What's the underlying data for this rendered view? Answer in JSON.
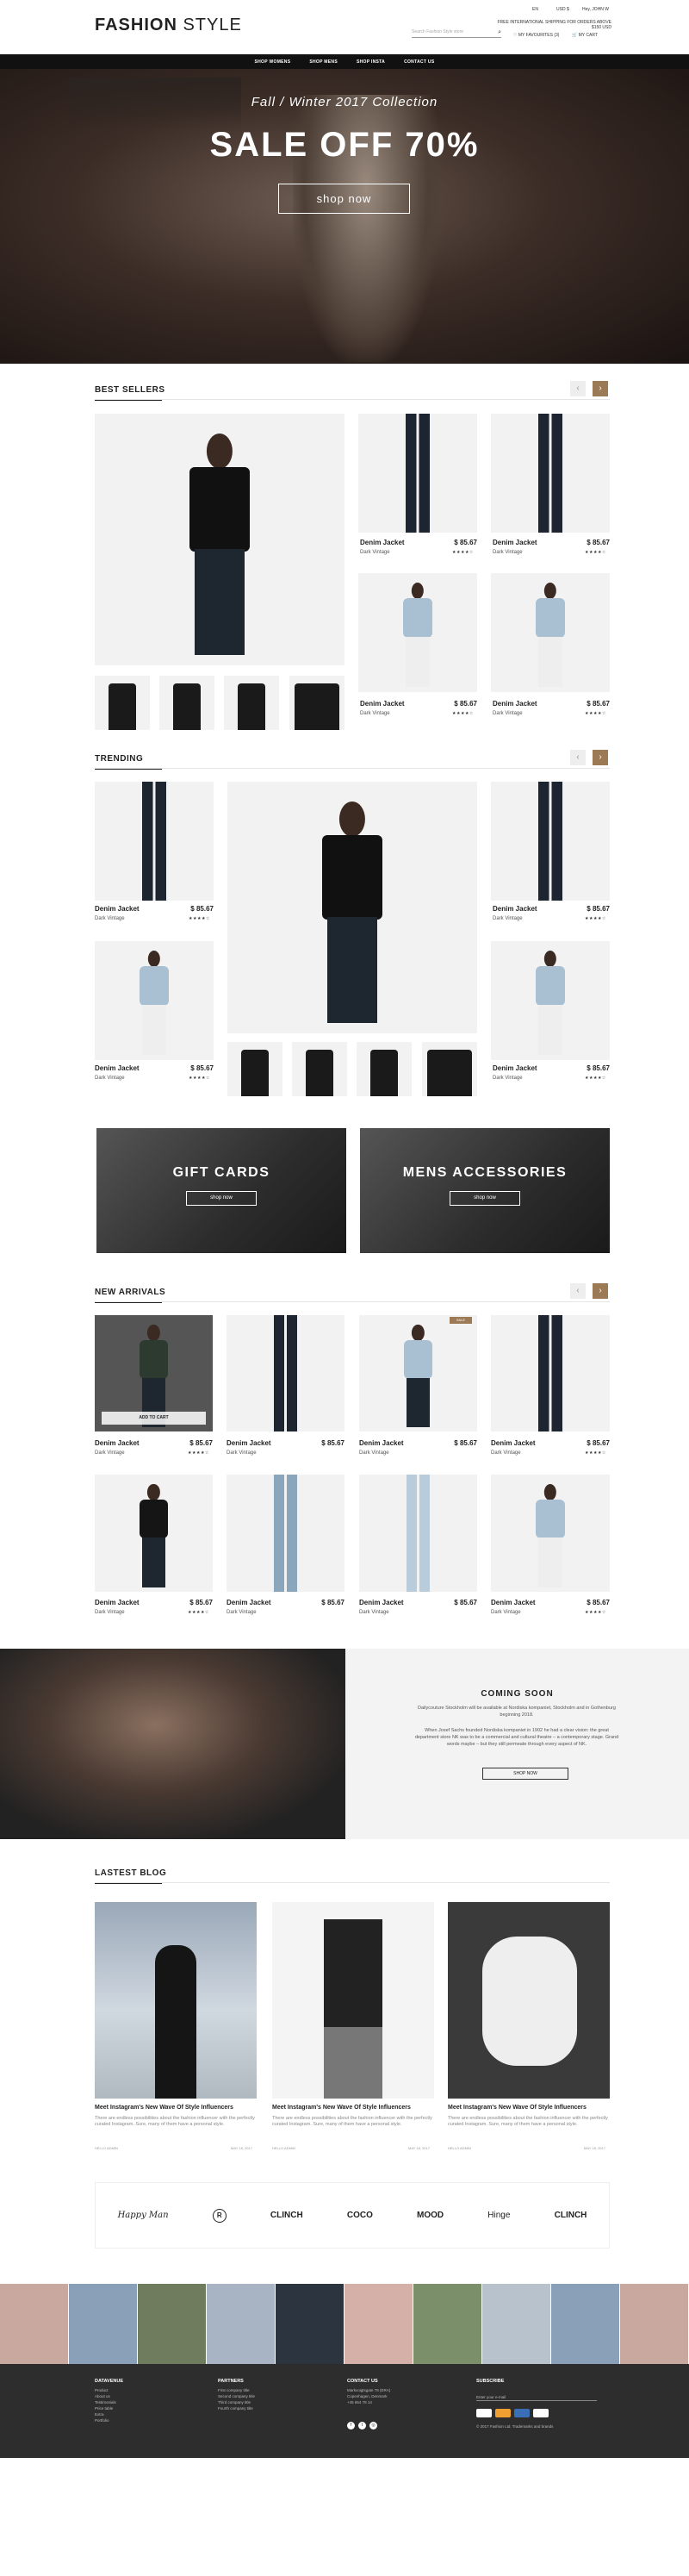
{
  "brand": {
    "logo_bold": "FASHION",
    "logo_light": "STYLE"
  },
  "topbar": {
    "language": "EN",
    "currency": "USD $",
    "account": "Hey, JOHN W",
    "shipping_note": "FREE INTERNATIONAL SHIPPING FOR ORDERS ABOVE $150 USD",
    "search_placeholder": "Search Fashion Style store",
    "favorites": "MY FAVOURITES (3)",
    "cart": "MY CART"
  },
  "nav": [
    "SHOP WOMENS",
    "SHOP MENS",
    "SHOP INSTA",
    "CONTACT US"
  ],
  "hero": {
    "subtitle": "Fall / Winter 2017 Collection",
    "title": "SALE OFF 70%",
    "button": "shop now"
  },
  "best_sellers": {
    "title": "BEST SELLERS",
    "products": [
      {
        "name": "Denim Jacket",
        "sub": "Dark Vintage",
        "price": "$ 85.67"
      },
      {
        "name": "Denim Jacket",
        "sub": "Dark Vintage",
        "price": "$ 85.67"
      },
      {
        "name": "Denim Jacket",
        "sub": "Dark Vintage",
        "price": "$ 85.67"
      },
      {
        "name": "Denim Jacket",
        "sub": "Dark Vintage",
        "price": "$ 85.67"
      }
    ]
  },
  "trending": {
    "title": "TRENDING",
    "products": [
      {
        "name": "Denim Jacket",
        "sub": "Dark Vintage",
        "price": "$ 85.67"
      },
      {
        "name": "Denim Jacket",
        "sub": "Dark Vintage",
        "price": "$ 85.67"
      },
      {
        "name": "Denim Jacket",
        "sub": "Dark Vintage",
        "price": "$ 85.67"
      },
      {
        "name": "Denim Jacket",
        "sub": "Dark Vintage",
        "price": "$ 85.67"
      }
    ]
  },
  "banners": [
    {
      "title": "GIFT CARDS",
      "button": "shop now"
    },
    {
      "title": "MENS ACCESSORIES",
      "button": "shop now"
    }
  ],
  "new_arrivals": {
    "title": "NEW ARRIVALS",
    "add_to_cart": "ADD TO CART",
    "sale_badge": "SALE",
    "products": [
      {
        "name": "Denim Jacket",
        "sub": "Dark Vintage",
        "price": "$ 85.67"
      },
      {
        "name": "Denim Jacket",
        "sub": "Dark Vintage",
        "price": "$ 85.67"
      },
      {
        "name": "Denim Jacket",
        "sub": "Dark Vintage",
        "price": "$ 85.67"
      },
      {
        "name": "Denim Jacket",
        "sub": "Dark Vintage",
        "price": "$ 85.67"
      },
      {
        "name": "Denim Jacket",
        "sub": "Dark Vintage",
        "price": "$ 85.67"
      },
      {
        "name": "Denim Jacket",
        "sub": "Dark Vintage",
        "price": "$ 85.67"
      },
      {
        "name": "Denim Jacket",
        "sub": "Dark Vintage",
        "price": "$ 85.67"
      },
      {
        "name": "Denim Jacket",
        "sub": "Dark Vintage",
        "price": "$ 85.67"
      }
    ]
  },
  "coming_soon": {
    "title": "COMING SOON",
    "p1": "Dailycouture Stockholm will be available at Nordiska kompaniet, Stockholm and in Gothenburg beginning 2018.",
    "p2": "When Josef Sachs founded Nordiska kompaniet in 1902 he had a clear vision: the great department store NK was to be a commercial and cultural theatre – a contemporary stage. Grand words maybe – but they still permeate through every aspect of NK.",
    "button": "SHOP NOW"
  },
  "blog": {
    "title": "LASTEST BLOG",
    "posts": [
      {
        "title": "Meet Instagram's New Wave Of Style Influencers",
        "desc": "There are endless possibilities about the fashion influencer with the perfectly curated Instagram. Sure, many of them have a personal style.",
        "author": "HELLO ADMIN",
        "date": "MAY 18, 2017"
      },
      {
        "title": "Meet Instagram's New Wave Of Style Influencers",
        "desc": "There are endless possibilities about the fashion influencer with the perfectly curated Instagram. Sure, many of them have a personal style.",
        "author": "HELLO ADMIN",
        "date": "MAY 18, 2017"
      },
      {
        "title": "Meet Instagram's New Wave Of Style Influencers",
        "desc": "There are endless possibilities about the fashion influencer with the perfectly curated Instagram. Sure, many of them have a personal style.",
        "author": "HELLO ADMIN",
        "date": "MAY 18, 2017"
      }
    ]
  },
  "brands": [
    "Happy Man",
    "R",
    "CLINCH",
    "COCO",
    "MOOD",
    "Hinge",
    "CLINCH"
  ],
  "footer": {
    "cols": [
      {
        "title": "DATAVENUE",
        "links": [
          "Product",
          "About us",
          "Testimonials",
          "Price table",
          "Extra",
          "Portfolio"
        ]
      },
      {
        "title": "PARTNERS",
        "links": [
          "First company title",
          "Second company title",
          "Third company title",
          "Fourth company title"
        ]
      },
      {
        "title": "CONTACT US",
        "links": [
          "Markvoigtsgate 78 (ERA)",
          "Copenhagen, Denmark",
          "+45 654 78 14"
        ]
      },
      {
        "title": "SUBSCRIBE",
        "links": [
          "Enter your e-mail",
          "© 2017 Fashion Ltd. Trademarks and brands"
        ]
      }
    ]
  }
}
